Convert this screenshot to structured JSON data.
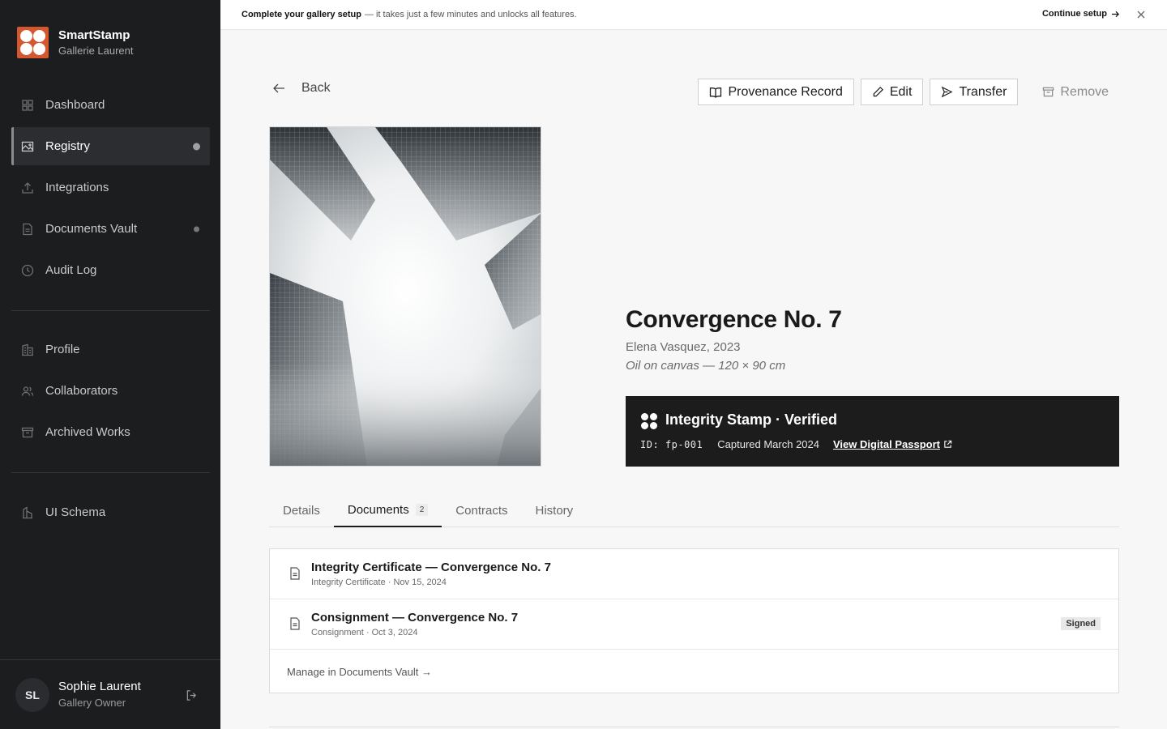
{
  "banner": {
    "strong": "Complete your gallery setup",
    "text": "— it takes just a few minutes and unlocks all features.",
    "cta": "Continue setup"
  },
  "brand": {
    "name": "SmartStamp",
    "sub": "Gallerie Laurent",
    "color": "#d4572f"
  },
  "sidebar": {
    "items": [
      {
        "label": "Dashboard",
        "icon": "grid-icon"
      },
      {
        "label": "Registry",
        "icon": "image-icon"
      },
      {
        "label": "Integrations",
        "icon": "upload-icon"
      },
      {
        "label": "Documents Vault",
        "icon": "document-icon"
      },
      {
        "label": "Audit Log",
        "icon": "clock-icon"
      },
      {
        "label": "Profile",
        "icon": "building-icon"
      },
      {
        "label": "Collaborators",
        "icon": "users-icon"
      },
      {
        "label": "Archived Works",
        "icon": "archive-icon"
      },
      {
        "label": "UI Schema",
        "icon": "schema-icon"
      }
    ]
  },
  "user": {
    "initials": "SL",
    "name": "Sophie Laurent",
    "role": "Gallery Owner"
  },
  "toolbar": {
    "back": "Back",
    "provenance": "Provenance Record",
    "edit": "Edit",
    "transfer": "Transfer",
    "remove": "Remove"
  },
  "artwork": {
    "title": "Convergence No. 7",
    "artist": "Elena Vasquez",
    "year": "2023",
    "medium": "Oil on canvas — 120 × 90 cm"
  },
  "stamp": {
    "title": "Integrity Stamp · Verified",
    "id": "ID: fp-001",
    "captured": "Captured March 2024",
    "link": "View Digital Passport"
  },
  "tabs": [
    {
      "label": "Details"
    },
    {
      "label": "Documents",
      "count": "2"
    },
    {
      "label": "Contracts"
    },
    {
      "label": "History"
    }
  ],
  "documents": [
    {
      "title": "Integrity Certificate — Convergence No. 7",
      "meta": "Integrity Certificate · Nov 15, 2024"
    },
    {
      "title": "Consignment — Convergence No. 7",
      "meta": "Consignment · Oct 3, 2024",
      "badge": "Signed"
    }
  ],
  "manage_link": "Manage in Documents Vault →"
}
